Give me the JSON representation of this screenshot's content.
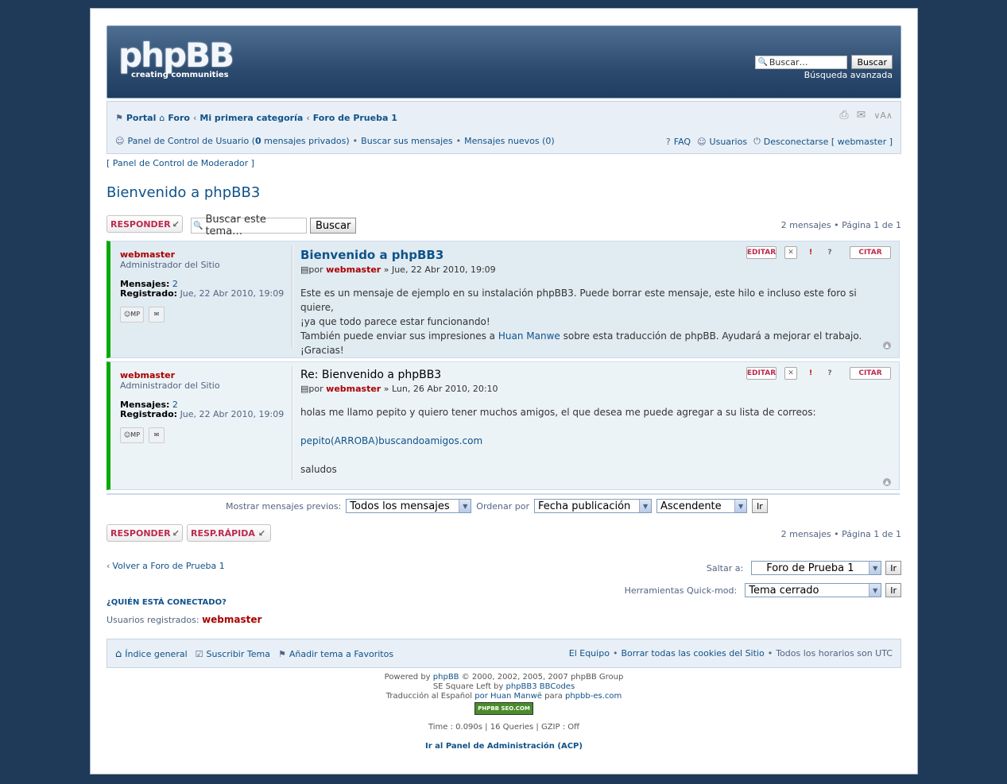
{
  "header": {
    "logo_text": "phpBB",
    "logo_tagline": "creating communities",
    "search_placeholder": "Buscar…",
    "search_button": "Buscar",
    "advanced_search": "Búsqueda avanzada"
  },
  "breadcrumb": {
    "items": [
      "Portal",
      "Foro",
      "Mi primera categoría",
      "Foro de Prueba 1"
    ]
  },
  "userbar": {
    "ucp": "Panel de Control de Usuario (",
    "pm_count": "0",
    "pm_suffix": " mensajes privados)",
    "search_own": "Buscar sus mensajes",
    "new_posts": "Mensajes nuevos (0)",
    "faq": "FAQ",
    "users": "Usuarios",
    "logout": "Desconectarse [ webmaster ]"
  },
  "mcp_link": "[ Panel de Control de Moderador ]",
  "topic_title": "Bienvenido a phpBB3",
  "actions_top": {
    "reply": "RESPONDER",
    "search_placeholder": "Buscar este tema…",
    "search_button": "Buscar",
    "pagination": "2 mensajes • Página 1 de 1"
  },
  "posts": [
    {
      "author": "webmaster",
      "rank": "Administrador del Sitio",
      "posts_label": "Mensajes:",
      "posts_value": "2",
      "joined_label": "Registrado:",
      "joined_value": "Jue, 22 Abr 2010, 19:09",
      "title": "Bienvenido a phpBB3",
      "by": "por",
      "date": "» Jue, 22 Abr 2010, 19:09",
      "line1": "Este es un mensaje de ejemplo en su instalación phpBB3. Puede borrar este mensaje, este hilo e incluso este foro si quiere,",
      "line2": "¡ya que todo parece estar funcionando!",
      "line3a": "También puede enviar sus impresiones a ",
      "line3link": "Huan Manwe",
      "line3b": " sobre esta traducción de phpBB. Ayudará a mejorar el trabajo.",
      "line4": "¡Gracias!"
    },
    {
      "author": "webmaster",
      "rank": "Administrador del Sitio",
      "posts_label": "Mensajes:",
      "posts_value": "2",
      "joined_label": "Registrado:",
      "joined_value": "Jue, 22 Abr 2010, 19:09",
      "title": "Re: Bienvenido a phpBB3",
      "by": "por",
      "date": "» Lun, 26 Abr 2010, 20:10",
      "line1": "holas me llamo pepito y quiero tener muchos amigos, el que desea me puede agregar a su lista de correos:",
      "link": "pepito(ARROBA)buscandoamigos.com",
      "line3": "saludos"
    }
  ],
  "post_buttons": {
    "edit": "EDITAR",
    "quote": "CITAR",
    "pm": "MP"
  },
  "sorting": {
    "show_label": "Mostrar mensajes previos:",
    "show_value": "Todos los mensajes",
    "order_label": "Ordenar por",
    "order_value": "Fecha publicación",
    "dir_value": "Ascendente",
    "go": "Ir"
  },
  "actions_bottom": {
    "reply": "RESPONDER",
    "quick_reply": "RESP.RÁPIDA",
    "pagination": "2 mensajes • Página 1 de 1"
  },
  "return_link": "Volver a Foro de Prueba 1",
  "jump": {
    "label": "Saltar a:",
    "value": "Foro de Prueba 1",
    "go": "Ir"
  },
  "quickmod": {
    "label": "Herramientas Quick-mod:",
    "value": "Tema cerrado",
    "go": "Ir"
  },
  "online": {
    "title": "¿QUIÉN ESTÁ CONECTADO?",
    "label": "Usuarios registrados:",
    "user": "webmaster"
  },
  "footer": {
    "index": "Índice general",
    "subscribe": "Suscribir Tema",
    "bookmark": "Añadir tema a Favoritos",
    "team": "El Equipo",
    "cookies": "Borrar todas las cookies del Sitio",
    "timezone": "Todos los horarios son UTC"
  },
  "copyright": {
    "line1a": "Powered by ",
    "line1link": "phpBB",
    "line1b": " © 2000, 2002, 2005, 2007 phpBB Group",
    "line2a": "SE Square Left by ",
    "line2link": "phpBB3 BBCodes",
    "line3a": "Traducción al Español ",
    "line3link1": "por Huan Manwë",
    "line3b": " para ",
    "line3link2": "phpbb-es.com",
    "badge": "PHPBB SEO.COM",
    "stats": "Time : 0.090s | 16 Queries | GZIP : Off",
    "acp": "Ir al Panel de Administración (ACP)"
  }
}
